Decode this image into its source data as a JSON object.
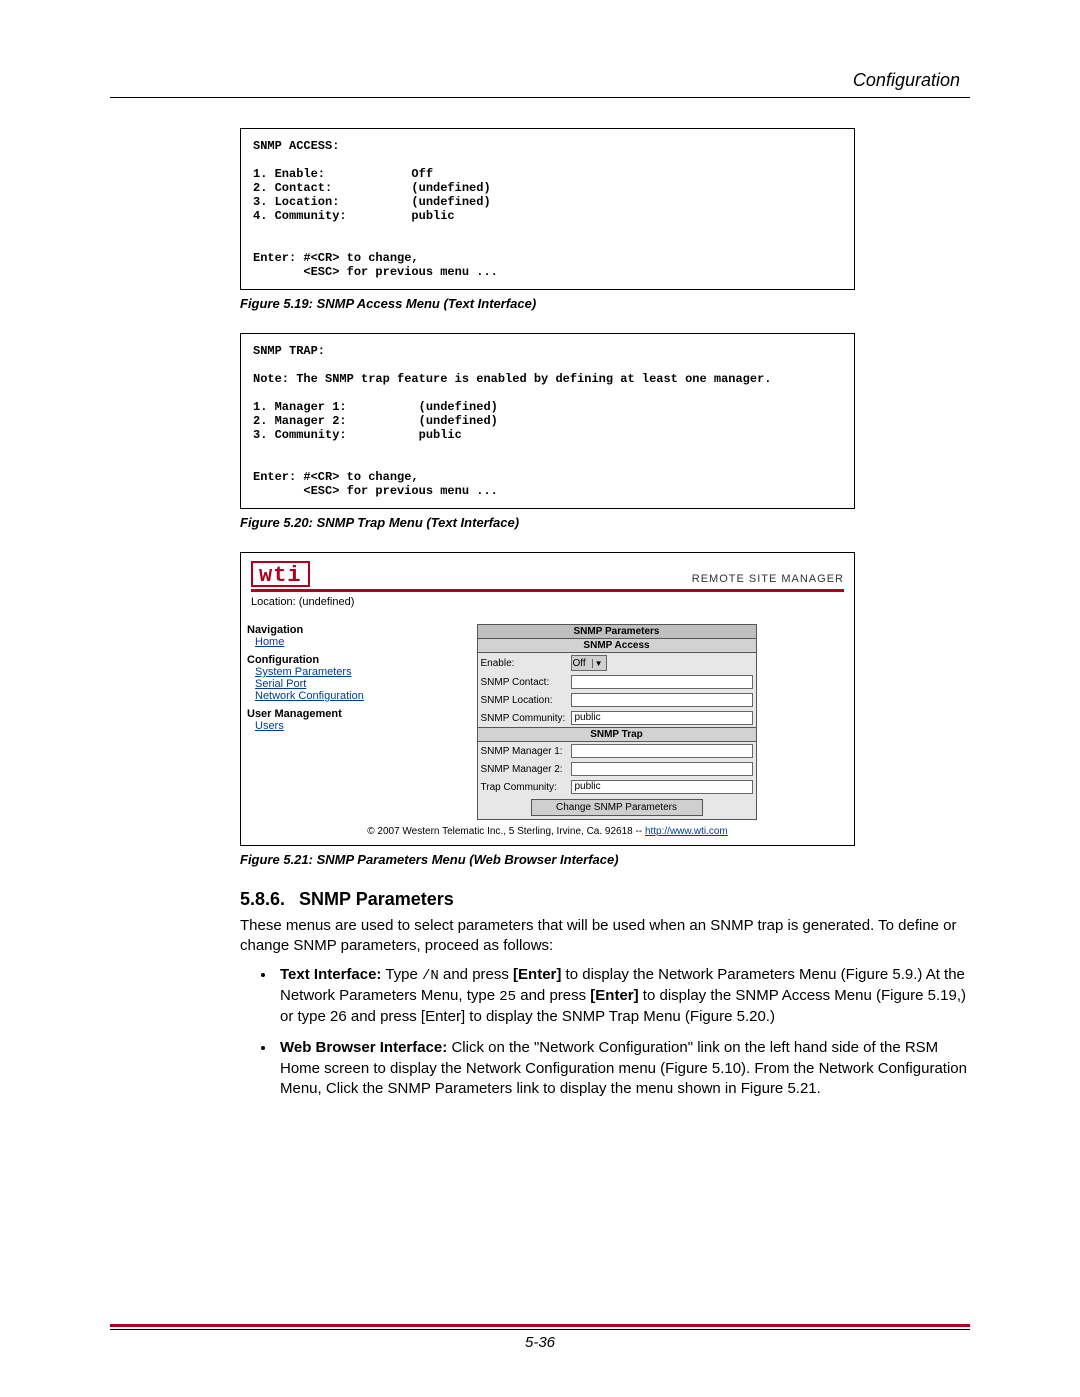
{
  "header": {
    "title": "Configuration"
  },
  "figures": {
    "f19": {
      "lines": [
        "SNMP ACCESS:",
        "",
        "1. Enable:            Off",
        "2. Contact:           (undefined)",
        "3. Location:          (undefined)",
        "4. Community:         public",
        "",
        "",
        "Enter: #<CR> to change,",
        "       <ESC> for previous menu ..."
      ],
      "caption": "Figure 5.19:  SNMP Access Menu (Text Interface)"
    },
    "f20": {
      "lines": [
        "SNMP TRAP:",
        "",
        "Note: The SNMP trap feature is enabled by defining at least one manager.",
        "",
        "1. Manager 1:          (undefined)",
        "2. Manager 2:          (undefined)",
        "3. Community:          public",
        "",
        "",
        "Enter: #<CR> to change,",
        "       <ESC> for previous menu ..."
      ],
      "caption": "Figure 5.20:  SNMP Trap Menu (Text Interface)"
    },
    "f21": {
      "brand": "wti",
      "site_label": "REMOTE SITE MANAGER",
      "location_label": "Location: (undefined)",
      "nav": {
        "nav_head": "Navigation",
        "home": "Home",
        "config_head": "Configuration",
        "sys_params": "System Parameters",
        "serial_port": "Serial Port",
        "net_config": "Network Configuration",
        "user_head": "User Management",
        "users": "Users"
      },
      "panel": {
        "title": "SNMP Parameters",
        "access_title": "SNMP Access",
        "trap_title": "SNMP Trap",
        "enable_label": "Enable:",
        "enable_value": "Off",
        "contact_label": "SNMP Contact:",
        "location_label": "SNMP Location:",
        "community_label": "SNMP Community:",
        "community_value": "public",
        "mgr1_label": "SNMP Manager 1:",
        "mgr2_label": "SNMP Manager 2:",
        "trap_comm_label": "Trap Community:",
        "trap_comm_value": "public",
        "button": "Change SNMP Parameters"
      },
      "footer_prefix": "© 2007 Western Telematic Inc., 5 Sterling, Irvine, Ca. 92618 -- ",
      "footer_link": "http://www.wti.com",
      "caption": "Figure 5.21:  SNMP Parameters Menu (Web Browser Interface)"
    }
  },
  "section": {
    "num": "5.8.6.",
    "title": "SNMP Parameters",
    "intro": "These menus are used to select parameters that will be used when an SNMP trap is generated.  To define or change SNMP parameters, proceed as follows:",
    "bullet1": {
      "lead": "Text Interface:",
      "t1": "  Type ",
      "cmd": "/N",
      "t2": " and press ",
      "k1": "[Enter]",
      "t3": " to display the Network Parameters Menu (Figure 5.9.)  At the Network Parameters Menu, type ",
      "num": "25",
      "t4": " and press ",
      "k2": "[Enter]",
      "t5": " to display the SNMP Access Menu (Figure 5.19,) or type 26 and press [Enter] to display the SNMP Trap Menu (Figure 5.20.)"
    },
    "bullet2": {
      "lead": "Web Browser Interface:",
      "text": "  Click on the \"Network Configuration\" link on the left hand side of the RSM Home screen to display the Network Configuration menu (Figure 5.10).  From the Network Configuration Menu, Click the SNMP Parameters link to display the menu shown in Figure 5.21."
    }
  },
  "page_number": "5-36"
}
